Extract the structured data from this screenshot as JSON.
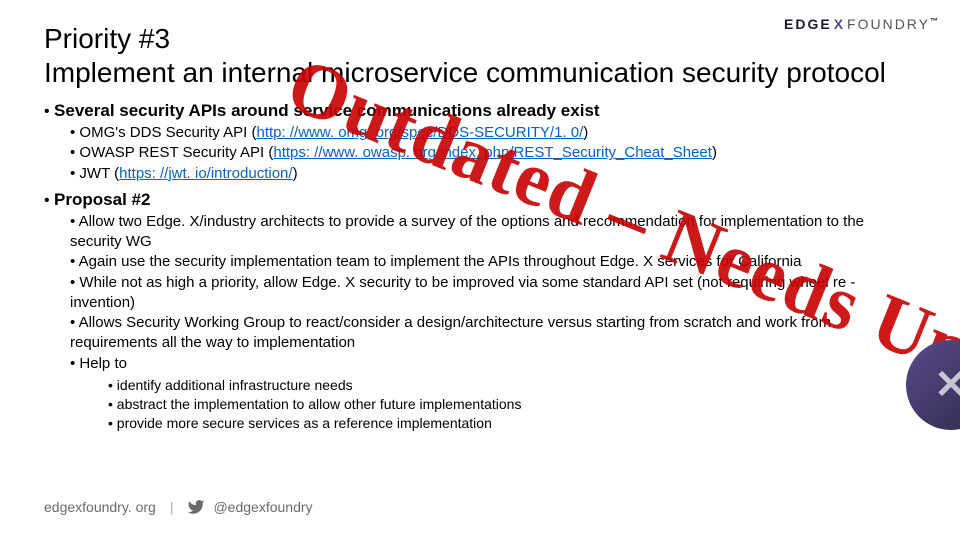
{
  "brand": {
    "edge": "EDGE",
    "x": "X",
    "foundry": "FOUNDRY",
    "tm": "™"
  },
  "title_line1": "Priority #3",
  "title_line2": "Implement an internal microservice communication security protocol",
  "b1": {
    "head": "Several security APIs around service communications already exist",
    "s1_pre": "OMG's DDS Security API (",
    "s1_link": "http: //www. omg. org/spec/DDS-SECURITY/1. 0/",
    "s1_post": ")",
    "s2_pre": "OWASP REST Security API (",
    "s2_link": "https: //www. owasp. org/index. php/REST_Security_Cheat_Sheet",
    "s2_post": ")",
    "s3_pre": "JWT (",
    "s3_link": "https: //jwt. io/introduction/",
    "s3_post": ")"
  },
  "b2": {
    "head": "Proposal #2",
    "s1": "Allow two Edge. X/industry architects to provide a survey of the options and recommendation for implementation to the security WG",
    "s2": "Again use the security implementation team to implement the APIs throughout Edge. X services for California",
    "s3": "While not as high a priority, allow Edge. X security to be improved via some standard API set (not requiring wheel re -invention)",
    "s4": "Allows Security Working Group to react/consider a design/architecture versus starting from scratch and work from requirements all the way to implementation",
    "s5": "Help to",
    "t1": "identify additional infrastructure needs",
    "t2": "abstract the implementation to allow other future implementations",
    "t3": "provide more secure services as a reference implementation"
  },
  "watermark": "Outdated – Needs Update",
  "footer": {
    "site": "edgexfoundry. org",
    "handle": "@edgexfoundry"
  }
}
